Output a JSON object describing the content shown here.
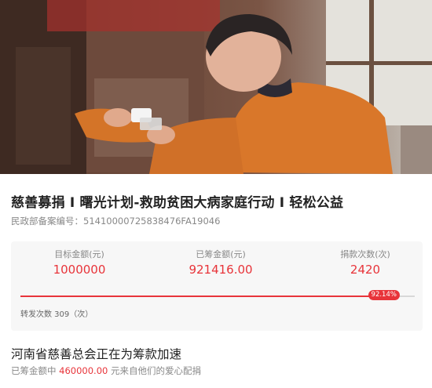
{
  "campaign": {
    "title": "慈善募捐 I 曙光计划-救助贫困大病家庭行动 I 轻松公益",
    "registration_label": "民政部备案编号：",
    "registration_number": "51410000725838476FA19046"
  },
  "stats": {
    "target_label": "目标金额(元)",
    "target_value": "1000000",
    "raised_label": "已筹金额(元)",
    "raised_value": "921416.00",
    "donations_label": "捐款次数(次)",
    "donations_value": "2420"
  },
  "progress": {
    "percent_label": "92.14%",
    "fraction": 0.9214,
    "shares_text": "转发次数 309（次）"
  },
  "organization": {
    "heading": "河南省慈善总会正在为筹款加速",
    "match_prefix": "已筹金额中",
    "match_amount": "460000.00",
    "match_suffix": "元来自他们的爱心配捐"
  },
  "colors": {
    "accent": "#e8343a"
  }
}
